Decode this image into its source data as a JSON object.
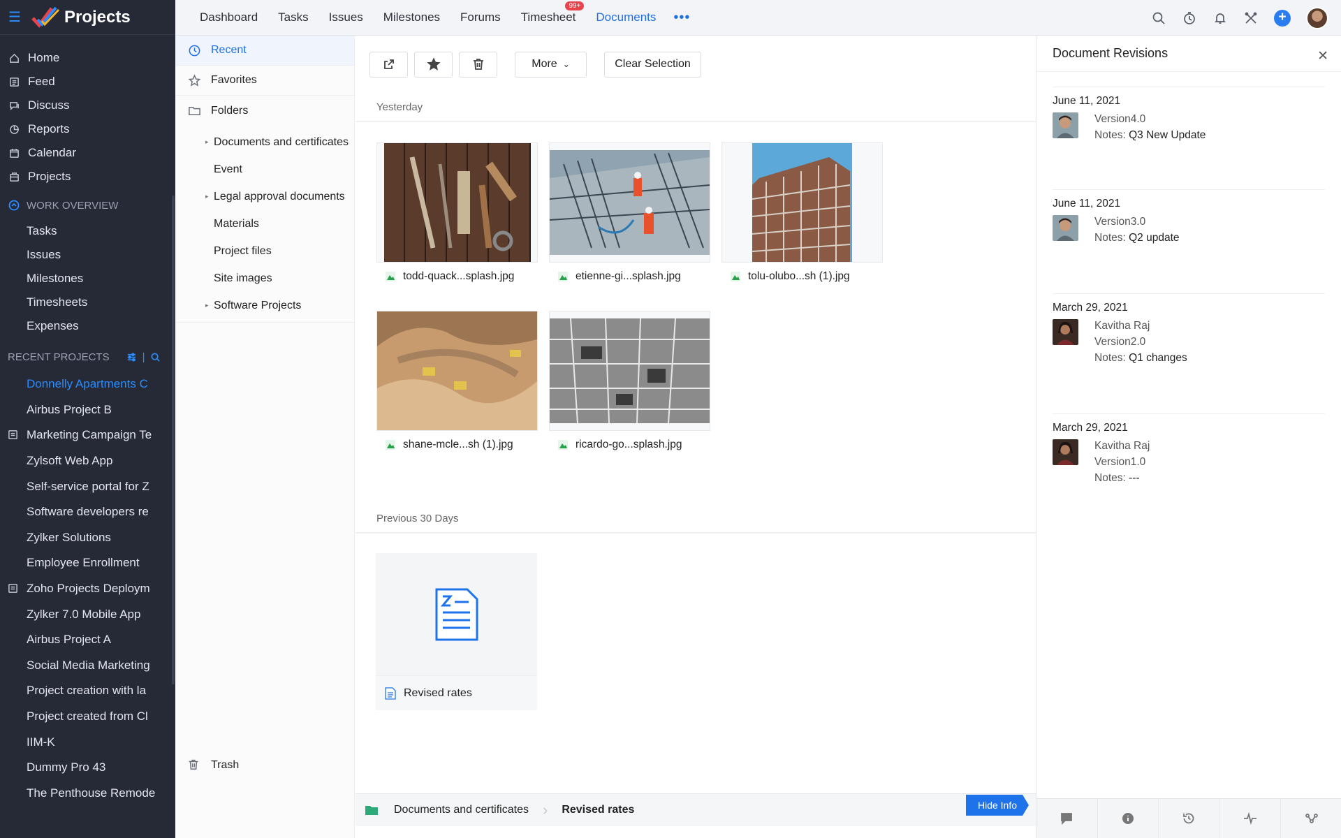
{
  "app": {
    "name": "Projects"
  },
  "sidebar": {
    "nav": [
      {
        "label": "Home",
        "icon": "home-icon"
      },
      {
        "label": "Feed",
        "icon": "feed-icon"
      },
      {
        "label": "Discuss",
        "icon": "discuss-icon"
      },
      {
        "label": "Reports",
        "icon": "reports-icon"
      },
      {
        "label": "Calendar",
        "icon": "calendar-icon"
      },
      {
        "label": "Projects",
        "icon": "projects-icon"
      }
    ],
    "work_overview": {
      "label": "WORK OVERVIEW",
      "items": [
        "Tasks",
        "Issues",
        "Milestones",
        "Timesheets",
        "Expenses"
      ]
    },
    "recent_projects_label": "RECENT PROJECTS",
    "recent_projects": [
      "Donnelly Apartments C",
      "Airbus Project B",
      "Marketing Campaign Te",
      "Zylsoft Web App",
      "Self-service portal for Z",
      "Software developers re",
      "Zylker Solutions",
      "Employee Enrollment",
      "Zoho Projects Deploym",
      "Zylker 7.0 Mobile App",
      "Airbus Project A",
      "Social Media Marketing",
      "Project creation with la",
      "Project created from Cl",
      "IIM-K",
      "Dummy Pro 43",
      "The Penthouse Remode"
    ]
  },
  "topnav": {
    "items": [
      "Dashboard",
      "Tasks",
      "Issues",
      "Milestones",
      "Forums",
      "Timesheet",
      "Documents"
    ],
    "timesheet_badge": "99+",
    "more": "•••"
  },
  "folders": {
    "recent": "Recent",
    "favorites": "Favorites",
    "folders": "Folders",
    "subfolders": [
      {
        "label": "Documents and certificates",
        "expandable": true
      },
      {
        "label": "Event",
        "expandable": false
      },
      {
        "label": "Legal approval documents",
        "expandable": true
      },
      {
        "label": "Materials",
        "expandable": false
      },
      {
        "label": "Project files",
        "expandable": false
      },
      {
        "label": "Site images",
        "expandable": false
      },
      {
        "label": "Software Projects",
        "expandable": true
      }
    ],
    "trash": "Trash"
  },
  "toolbar": {
    "more": "More",
    "clear": "Clear Selection"
  },
  "groups": {
    "yesterday": "Yesterday",
    "previous": "Previous 30 Days"
  },
  "files": [
    {
      "name": "todd-quack...splash.jpg"
    },
    {
      "name": "etienne-gi...splash.jpg"
    },
    {
      "name": "tolu-olubo...sh (1).jpg"
    },
    {
      "name": "shane-mcle...sh (1).jpg"
    },
    {
      "name": "ricardo-go...splash.jpg"
    }
  ],
  "doc": {
    "name": "Revised rates"
  },
  "breadcrumb": {
    "folder": "Documents and certificates",
    "current": "Revised rates",
    "hide_info": "Hide Info"
  },
  "revisions": {
    "title": "Document Revisions",
    "items": [
      {
        "date": "June 11, 2021",
        "author": "",
        "version": "Version4.0",
        "notes_label": "Notes:",
        "notes": "Q3 New Update"
      },
      {
        "date": "June 11, 2021",
        "author": "",
        "version": "Version3.0",
        "notes_label": "Notes:",
        "notes": "Q2 update"
      },
      {
        "date": "March 29, 2021",
        "author": "Kavitha Raj",
        "version": "Version2.0",
        "notes_label": "Notes:",
        "notes": "Q1 changes"
      },
      {
        "date": "March 29, 2021",
        "author": "Kavitha Raj",
        "version": "Version1.0",
        "notes_label": "Notes:",
        "notes": "---"
      }
    ]
  },
  "colors": {
    "accent": "#1f6fe5",
    "sidebar_bg": "#252a36",
    "badge": "#e8434a"
  }
}
